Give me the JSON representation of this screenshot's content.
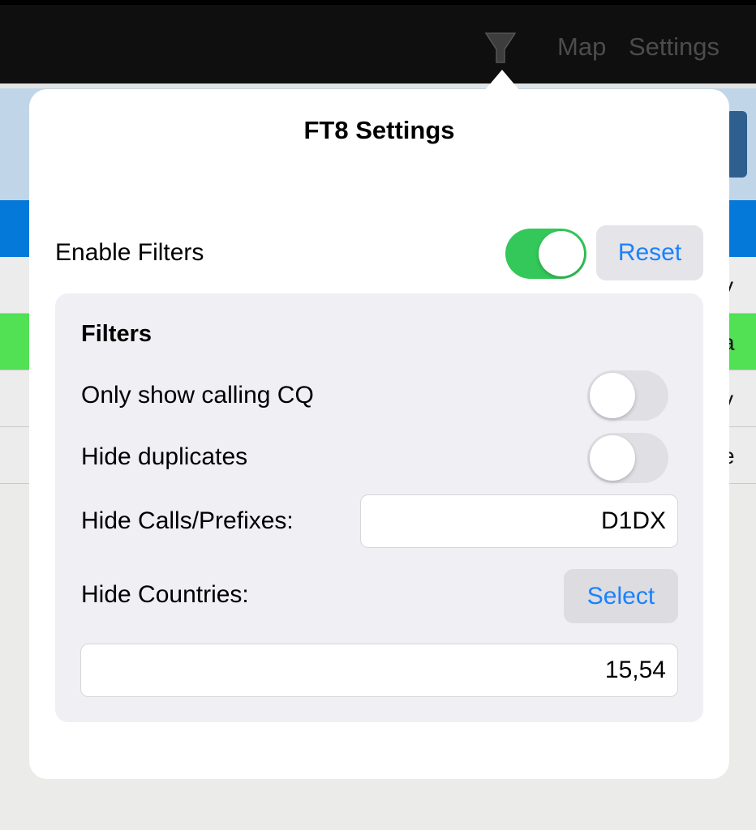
{
  "topbar": {
    "filter_icon": "funnel-icon",
    "nav_items": [
      {
        "label": "Map"
      },
      {
        "label": "Settings"
      }
    ]
  },
  "background_rows": [
    {
      "partial_text": "y",
      "highlight": false
    },
    {
      "partial_text": "a",
      "highlight": true
    },
    {
      "partial_text": "y",
      "highlight": false
    },
    {
      "partial_text": "e",
      "highlight": false
    }
  ],
  "popover": {
    "title": "FT8 Settings",
    "enable_filters": {
      "label": "Enable Filters",
      "on": true
    },
    "reset_label": "Reset",
    "filters": {
      "heading": "Filters",
      "only_cq": {
        "label": "Only show calling CQ",
        "on": false
      },
      "hide_duplicates": {
        "label": "Hide duplicates",
        "on": false
      },
      "hide_calls": {
        "label": "Hide Calls/Prefixes:",
        "value": "D1DX"
      },
      "hide_countries": {
        "label": "Hide Countries:",
        "select_label": "Select",
        "value": "15,54"
      }
    }
  },
  "colors": {
    "accent": "#1a82fb",
    "toggle_on": "#34c759",
    "toggle_off": "#dfdfe4",
    "panel_bg": "#efeff4",
    "header_blue": "#0579d9",
    "row_green": "#52e055"
  }
}
